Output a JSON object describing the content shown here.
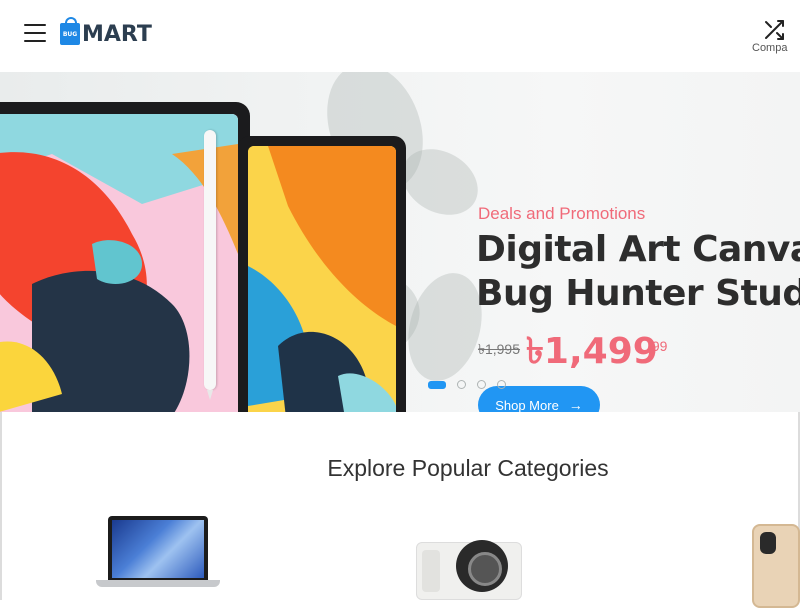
{
  "header": {
    "logo_badge": "BUG",
    "logo_text": "MART",
    "compare_label": "Compa",
    "icons": [
      "menu-icon",
      "shuffle-icon"
    ]
  },
  "hero": {
    "promo": "Deals and Promotions",
    "headline_line1": "Digital Art Canvas",
    "headline_line2": "Bug Hunter Studio",
    "old_price": "৳1,995",
    "new_price": "৳1,499",
    "new_price_cents": ".99",
    "button_label": "Shop More",
    "button_arrow": "→",
    "slides_total": 4,
    "slide_active": 1,
    "accent_color": "#f06a79",
    "button_color": "#2196f3"
  },
  "categories": {
    "title": "Explore Popular Categories",
    "items": [
      "laptop-image",
      "camera-image",
      "phone-image"
    ]
  }
}
